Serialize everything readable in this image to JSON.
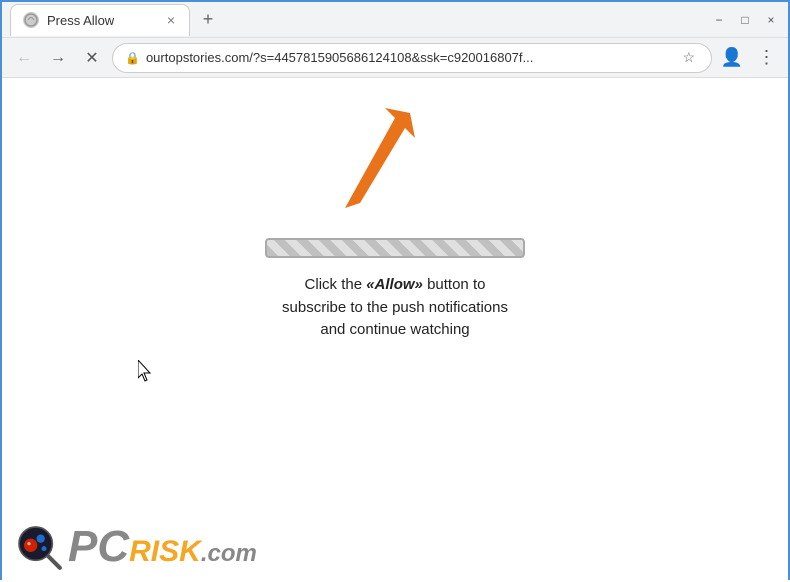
{
  "window": {
    "title": "Press Allow",
    "tab_close_label": "×",
    "new_tab_label": "+",
    "minimize_label": "−",
    "maximize_label": "□",
    "close_label": "×"
  },
  "addressbar": {
    "url": "ourtopstories.com/?s=4457815905686124108&ssk=c920016807f...",
    "lock_icon": "🔒"
  },
  "page": {
    "message_part1": "Click the ",
    "message_allow": "«Allow»",
    "message_part2": " button to subscribe to the push notifications and continue watching"
  },
  "logo": {
    "pc_text": "PC",
    "risk_text": "RISK",
    "dot_com": ".com"
  }
}
